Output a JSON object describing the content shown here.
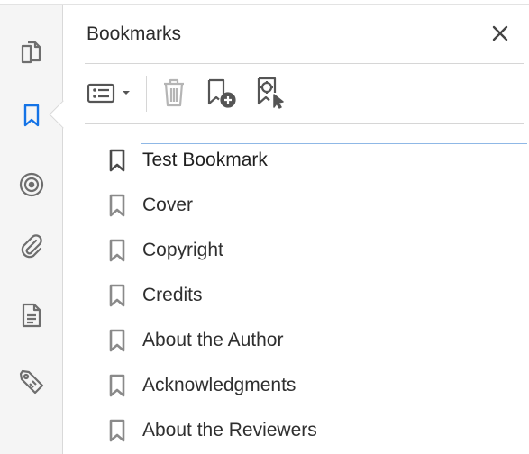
{
  "panel": {
    "title": "Bookmarks"
  },
  "rail": {
    "items": [
      {
        "name": "pages-icon",
        "active": false
      },
      {
        "name": "bookmark-icon",
        "active": true
      },
      {
        "name": "target-icon",
        "active": false
      },
      {
        "name": "attachment-icon",
        "active": false
      },
      {
        "name": "document-icon",
        "active": false
      },
      {
        "name": "tag-icon",
        "active": false
      }
    ],
    "active_color": "#1473e6",
    "icon_color": "#6e6e6e"
  },
  "toolbar": {
    "options": "options-menu-icon",
    "delete": "trash-icon",
    "new": "new-bookmark-icon",
    "find": "find-current-bookmark-icon"
  },
  "bookmarks": [
    {
      "label": "Test Bookmark",
      "selected": true
    },
    {
      "label": "Cover",
      "selected": false
    },
    {
      "label": "Copyright",
      "selected": false
    },
    {
      "label": "Credits",
      "selected": false
    },
    {
      "label": "About the Author",
      "selected": false
    },
    {
      "label": "Acknowledgments",
      "selected": false
    },
    {
      "label": "About the Reviewers",
      "selected": false
    }
  ]
}
